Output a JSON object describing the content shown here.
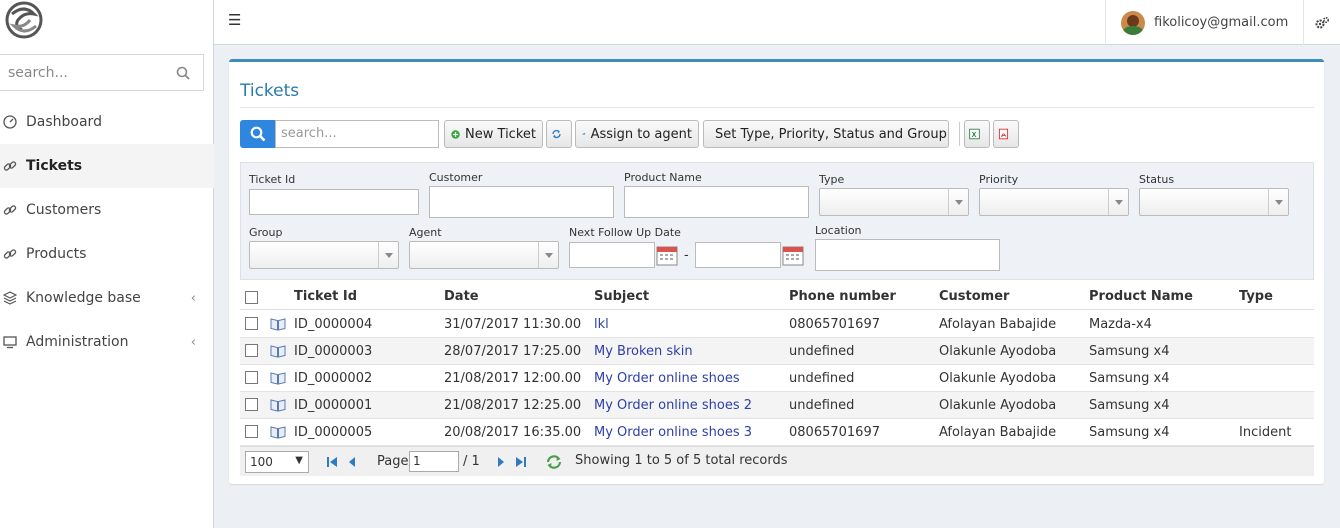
{
  "sidebar": {
    "search_placeholder": "search...",
    "items": [
      {
        "label": "Dashboard",
        "icon": "dashboard-icon"
      },
      {
        "label": "Tickets",
        "icon": "link-icon",
        "active": true
      },
      {
        "label": "Customers",
        "icon": "link-icon"
      },
      {
        "label": "Products",
        "icon": "link-icon"
      },
      {
        "label": "Knowledge base",
        "icon": "layers-icon",
        "has_children": true
      },
      {
        "label": "Administration",
        "icon": "monitor-icon",
        "has_children": true
      }
    ]
  },
  "topbar": {
    "user_email": "fikolicoy@gmail.com"
  },
  "page": {
    "title": "Tickets"
  },
  "toolbar": {
    "search_placeholder": "search...",
    "new_ticket": "New Ticket",
    "assign_to_agent": "Assign to agent",
    "set_type": "Set Type, Priority, Status and Group"
  },
  "filters": {
    "ticket_id": "Ticket Id",
    "customer": "Customer",
    "product_name": "Product Name",
    "type": "Type",
    "priority": "Priority",
    "status": "Status",
    "group": "Group",
    "agent": "Agent",
    "next_follow_up_date": "Next Follow Up Date",
    "date_separator": "-",
    "location": "Location"
  },
  "table": {
    "headers": {
      "ticket_id": "Ticket Id",
      "date": "Date",
      "subject": "Subject",
      "phone": "Phone number",
      "customer": "Customer",
      "product": "Product Name",
      "type": "Type"
    },
    "rows": [
      {
        "ticket_id": "ID_0000004",
        "date": "31/07/2017 11:30.00",
        "subject": "lkl",
        "phone": "08065701697",
        "customer": "Afolayan Babajide",
        "product": "Mazda-x4",
        "type": ""
      },
      {
        "ticket_id": "ID_0000003",
        "date": "28/07/2017 17:25.00",
        "subject": "My Broken skin",
        "phone": "undefined",
        "customer": "Olakunle Ayodoba",
        "product": "Samsung x4",
        "type": ""
      },
      {
        "ticket_id": "ID_0000002",
        "date": "21/08/2017 12:00.00",
        "subject": "My Order online shoes",
        "phone": "undefined",
        "customer": "Olakunle Ayodoba",
        "product": "Samsung x4",
        "type": ""
      },
      {
        "ticket_id": "ID_0000001",
        "date": "21/08/2017 12:25.00",
        "subject": "My Order online shoes 2",
        "phone": "undefined",
        "customer": "Olakunle Ayodoba",
        "product": "Samsung x4",
        "type": ""
      },
      {
        "ticket_id": "ID_0000005",
        "date": "20/08/2017 16:35.00",
        "subject": "My Order online shoes 3",
        "phone": "08065701697",
        "customer": "Afolayan Babajide",
        "product": "Samsung x4",
        "type": "Incident"
      }
    ]
  },
  "pager": {
    "page_size": "100",
    "page_label": "Page",
    "page_value": "1",
    "page_total": "/ 1",
    "summary": "Showing 1 to 5 of 5 total records"
  },
  "colors": {
    "accent": "#3c8dbc",
    "search_button": "#2e86de",
    "link": "#2d3fa8"
  }
}
